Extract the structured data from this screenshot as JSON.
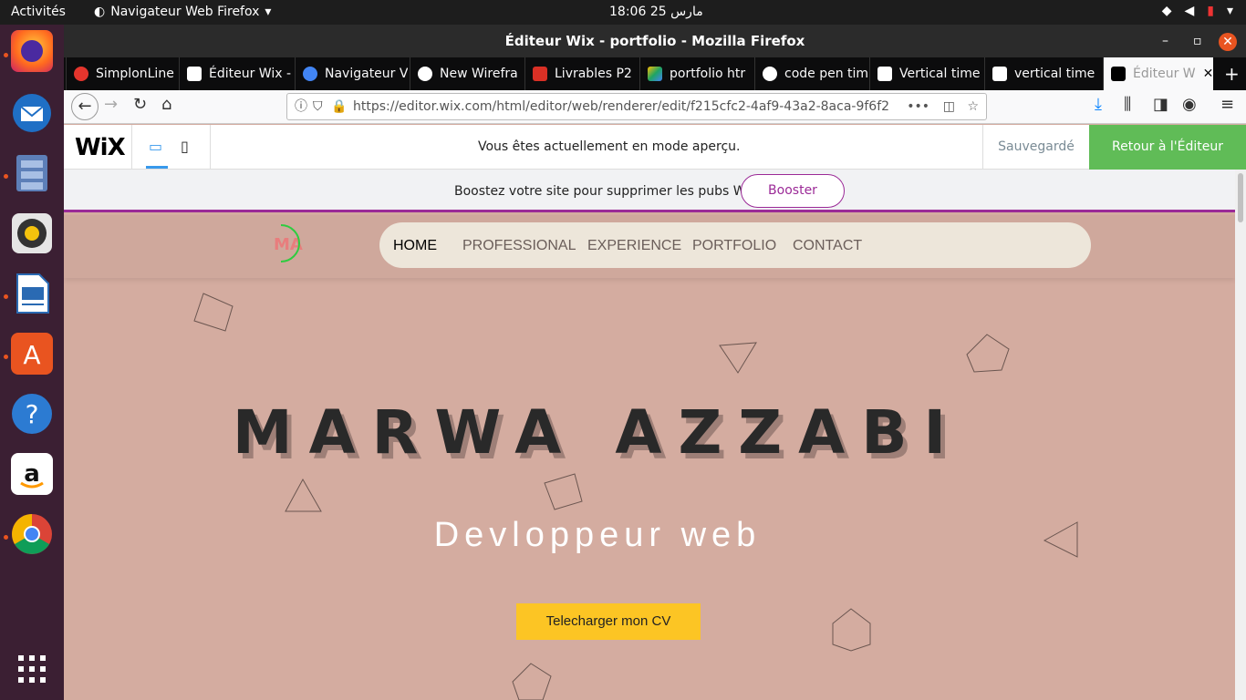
{
  "topbar": {
    "activities": "Activités",
    "app_name": "Navigateur Web Firefox",
    "clock": "مارس 25  18:06"
  },
  "window": {
    "title": "Éditeur Wix - portfolio - Mozilla Firefox"
  },
  "tabs": [
    {
      "label": "SimplonLine",
      "color": "#e4352d"
    },
    {
      "label": "Éditeur Wix -",
      "color": "#000000"
    },
    {
      "label": "Navigateur V",
      "color": "#4285f4"
    },
    {
      "label": "New Wirefra",
      "color": "#222222"
    },
    {
      "label": "Livrables P2",
      "color": "#d93025"
    },
    {
      "label": "portfolio htr",
      "color": "#1fa463"
    },
    {
      "label": "code pen tim",
      "color": "#4285f4"
    },
    {
      "label": "Vertical time",
      "color": "#111111"
    },
    {
      "label": "vertical time",
      "color": "#111111"
    },
    {
      "label": "Éditeur W",
      "color": "#000000"
    }
  ],
  "url": {
    "text": "https://editor.wix.com/html/editor/web/renderer/edit/f215cfc2-4af9-43a2-8aca-9f6f2"
  },
  "wix": {
    "logo": "WiX",
    "preview_msg": "Vous êtes actuellement en mode aperçu.",
    "saved": "Sauvegardé",
    "back": "Retour à l'Éditeur"
  },
  "promo": {
    "text": "Boostez votre site pour supprimer les pubs Wix",
    "button": "Booster"
  },
  "site": {
    "logo": "MA",
    "nav": [
      "HOME",
      "PROFESSIONAL",
      "EXPERIENCE",
      "PORTFOLIO",
      "CONTACT"
    ],
    "name": "MARWA AZZABI",
    "role": "Devloppeur web",
    "cv_button": "Telecharger mon CV"
  }
}
